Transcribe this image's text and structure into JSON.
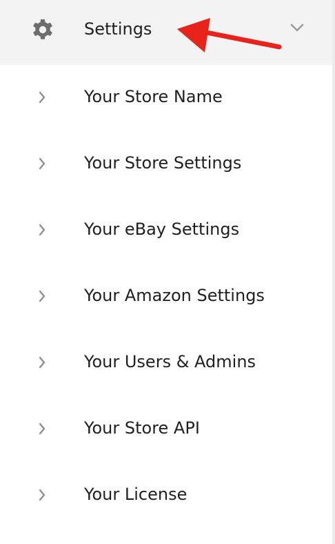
{
  "colors": {
    "header_background": "#f3f3f3",
    "text": "#1f1f1f",
    "icon": "#6d6d6d",
    "chevron": "#8f8f8f",
    "annotation_arrow": "#e8231a"
  },
  "header": {
    "icon": "gear-icon",
    "label": "Settings",
    "toggle_icon": "chevron-down-icon"
  },
  "annotation": {
    "icon": "red-arrow-icon"
  },
  "items": [
    {
      "label": "Your Store Name",
      "icon": "chevron-right-icon"
    },
    {
      "label": "Your Store Settings",
      "icon": "chevron-right-icon"
    },
    {
      "label": "Your eBay Settings",
      "icon": "chevron-right-icon"
    },
    {
      "label": "Your Amazon Settings",
      "icon": "chevron-right-icon"
    },
    {
      "label": "Your Users & Admins",
      "icon": "chevron-right-icon"
    },
    {
      "label": "Your Store API",
      "icon": "chevron-right-icon"
    },
    {
      "label": "Your License",
      "icon": "chevron-right-icon"
    }
  ]
}
